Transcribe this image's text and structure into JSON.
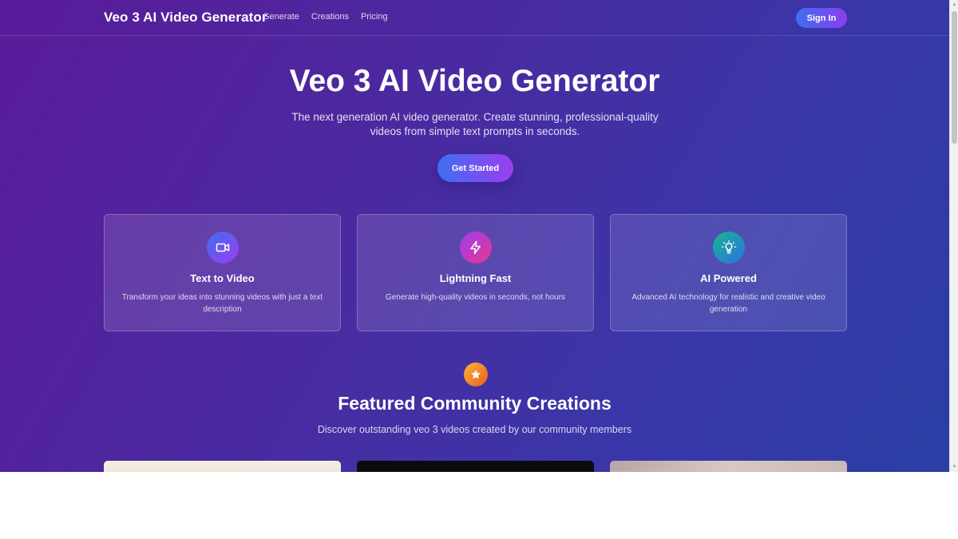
{
  "header": {
    "logo": "Veo 3 AI Video Generator",
    "nav": [
      "Generate",
      "Creations",
      "Pricing"
    ],
    "sign_in": "Sign In"
  },
  "hero": {
    "title": "Veo 3 AI Video Generator",
    "description": "The next generation AI video generator. Create stunning, professional-quality videos from simple text prompts in seconds.",
    "cta": "Get Started"
  },
  "features": [
    {
      "title": "Text to Video",
      "description": "Transform your ideas into stunning videos with just a text description",
      "icon": "video-camera-icon",
      "color_from": "#3f6ef0",
      "color_to": "#9b3df0"
    },
    {
      "title": "Lightning Fast",
      "description": "Generate high-quality videos in seconds, not hours",
      "icon": "lightning-icon",
      "color_from": "#9b3df0",
      "color_to": "#e8388f"
    },
    {
      "title": "AI Powered",
      "description": "Advanced AI technology for realistic and creative video generation",
      "icon": "lightbulb-icon",
      "color_from": "#14b88a",
      "color_to": "#2f6fe6"
    }
  ],
  "featured": {
    "icon": "star-icon",
    "title": "Featured Community Creations",
    "description": "Discover outstanding veo 3 videos created by our community members"
  },
  "colors": {
    "accent_from": "#3f6ef0",
    "accent_to": "#9b3df0",
    "background_from": "#5b1b9a",
    "background_to": "#2a3ea6"
  }
}
